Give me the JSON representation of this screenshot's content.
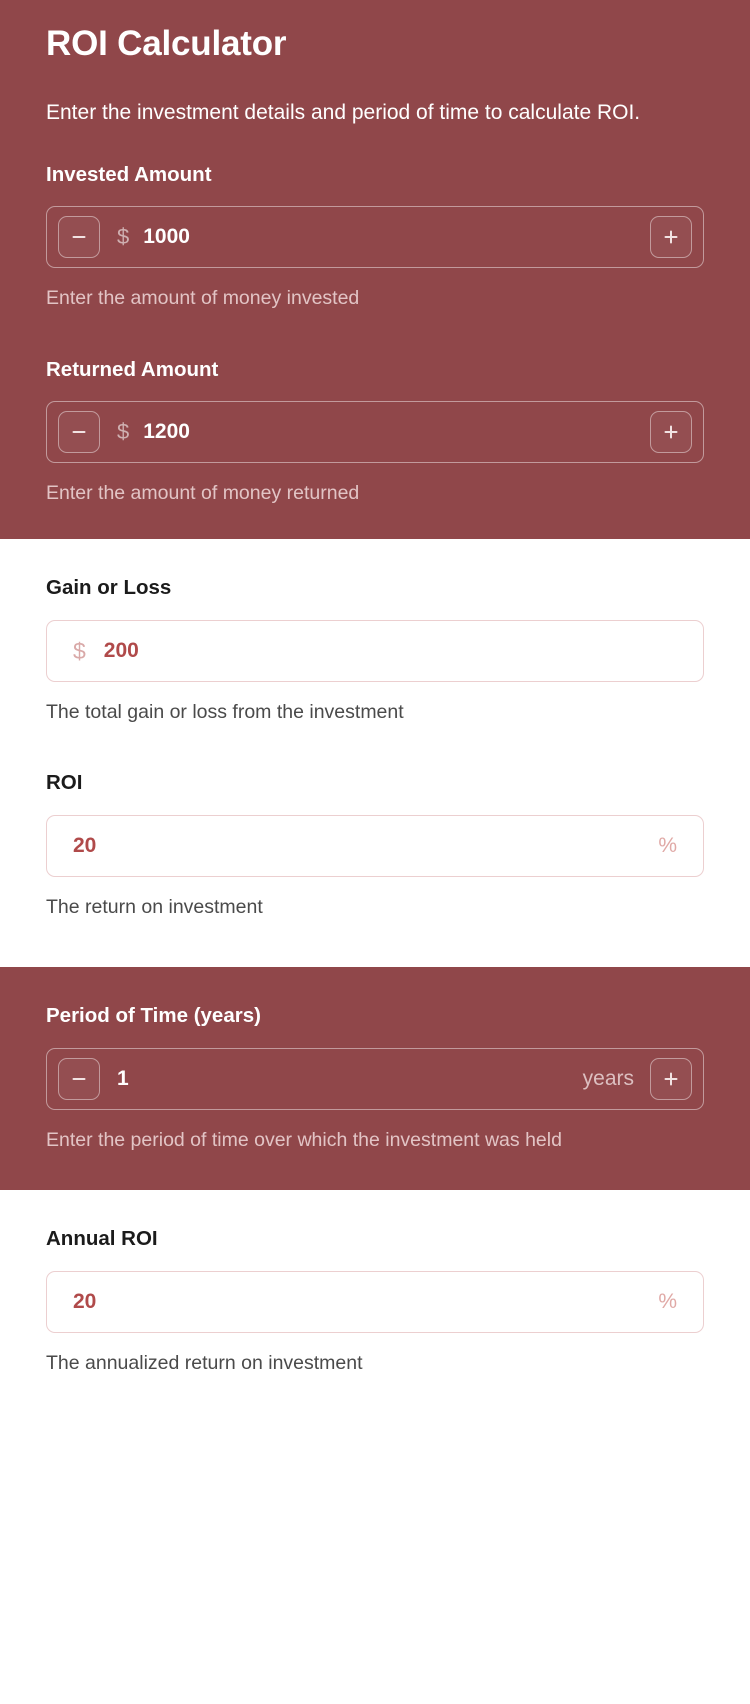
{
  "header": {
    "title": "ROI Calculator",
    "description": "Enter the investment details and period of time to calculate ROI."
  },
  "theme": {
    "accent_red": "#90474a",
    "card_background": "#ffffff",
    "value_red": "#b04a4a",
    "border_light_pink": "#eccfd0",
    "border_on_red": "#c29a9c"
  },
  "fields": {
    "invested_amount": {
      "label": "Invested Amount",
      "currency_symbol": "$",
      "value": "1000",
      "help": "Enter the amount of money invested",
      "decrement_label": "−",
      "increment_label": "+"
    },
    "returned_amount": {
      "label": "Returned Amount",
      "currency_symbol": "$",
      "value": "1200",
      "help": "Enter the amount of money returned",
      "decrement_label": "−",
      "increment_label": "+"
    },
    "gain_or_loss": {
      "label": "Gain or Loss",
      "currency_symbol": "$",
      "value": "200",
      "help": "The total gain or loss from the investment"
    },
    "roi": {
      "label": "ROI",
      "value": "20",
      "unit": "%",
      "help": "The return on investment"
    },
    "period_of_time": {
      "label": "Period of Time (years)",
      "value": "1",
      "unit": "years",
      "help": "Enter the period of time over which the investment was held",
      "decrement_label": "−",
      "increment_label": "+"
    },
    "annual_roi": {
      "label": "Annual ROI",
      "value": "20",
      "unit": "%",
      "help": "The annualized return on investment"
    }
  }
}
